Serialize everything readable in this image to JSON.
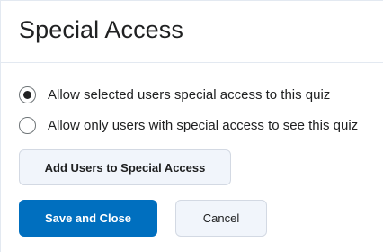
{
  "dialog": {
    "title": "Special Access"
  },
  "options": [
    {
      "label": "Allow selected users special access to this quiz",
      "selected": true
    },
    {
      "label": "Allow only users with special access to see this quiz",
      "selected": false
    }
  ],
  "buttons": {
    "add_users": "Add Users to Special Access",
    "save_close": "Save and Close",
    "cancel": "Cancel"
  },
  "colors": {
    "primary": "#006fbf",
    "secondary_bg": "#f1f5fb",
    "border": "#d3d9e3",
    "text": "#202122"
  }
}
